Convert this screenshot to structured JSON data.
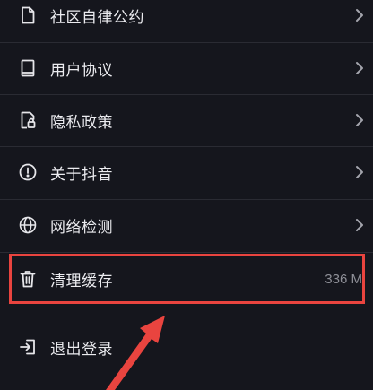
{
  "menu": {
    "items": [
      {
        "label": "社区自律公约",
        "icon": "document-icon"
      },
      {
        "label": "用户协议",
        "icon": "book-icon"
      },
      {
        "label": "隐私政策",
        "icon": "lock-document-icon"
      },
      {
        "label": "关于抖音",
        "icon": "info-icon"
      },
      {
        "label": "网络检测",
        "icon": "globe-icon"
      },
      {
        "label": "清理缓存",
        "icon": "trash-icon",
        "value": "336 M"
      },
      {
        "label": "退出登录",
        "icon": "logout-icon"
      }
    ]
  },
  "colors": {
    "background": "#15161d",
    "text": "#ececf0",
    "secondary_text": "#8e8f97",
    "highlight": "#e9443f"
  }
}
